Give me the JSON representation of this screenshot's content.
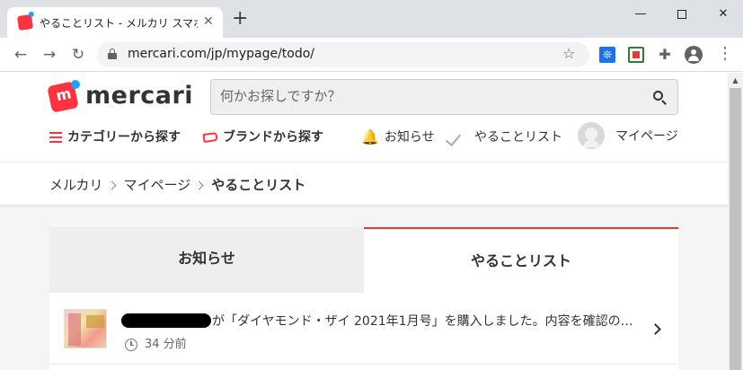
{
  "browser": {
    "tab_title": "やることリスト - メルカリ スマホでかんたん",
    "tab_close": "✕",
    "new_tab": "+",
    "window_controls": {
      "minimize": "—",
      "close": "✕"
    },
    "nav": {
      "back": "←",
      "forward": "→",
      "reload": "↻"
    },
    "url": "mercari.com/jp/mypage/todo/",
    "bookmark_icon": "☆",
    "extensions": {
      "ext1": "❊",
      "puzzle": "✚"
    },
    "menu": "⋮"
  },
  "site": {
    "logo_text": "mercari",
    "search": {
      "placeholder": "何かお探しですか？"
    },
    "subnav": {
      "category": "カテゴリーから探す",
      "brand": "ブランドから探す",
      "notifications": "お知らせ",
      "todo": "やることリスト",
      "mypage": "マイページ"
    },
    "bell_icon": "🔔",
    "breadcrumb": [
      "メルカリ",
      "マイページ",
      "やることリスト"
    ]
  },
  "tabs": {
    "notifications": "お知らせ",
    "todo": "やることリスト"
  },
  "todo_items": [
    {
      "text": "が「ダイヤモンド・ザイ 2021年1月号」を購入しました。内容を確認の…",
      "time": "34 分前"
    }
  ],
  "colors": {
    "brand_red": "#ff333f",
    "brand_blue": "#1aa2ff",
    "active_tab_border": "#ea352d"
  }
}
